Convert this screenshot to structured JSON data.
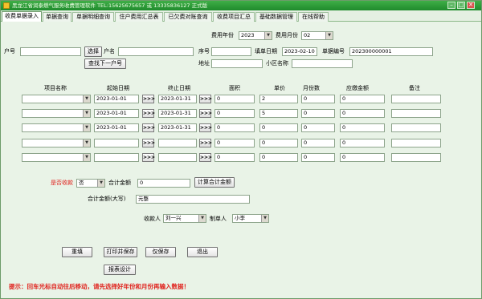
{
  "window": {
    "title": "黑龙江省润泰燃气服务收费管理软件 TEL:15625675657 或 13335836127 正式版",
    "min": "–",
    "max": "□",
    "close": "✕"
  },
  "tabs": [
    "收费单据录入",
    "单据查询",
    "单据明细查询",
    "住户费用汇总表",
    "已欠费对账查询",
    "收费项目汇总",
    "基础数据管理",
    "在线帮助"
  ],
  "period": {
    "year_label": "费用年份",
    "year_value": "2023",
    "month_label": "费用月份",
    "month_value": "02"
  },
  "customer": {
    "account_label": "户号",
    "account_value": "",
    "select_button": "选择",
    "find_next_button": "查找下一户号",
    "name_label": "户名",
    "name_value": "",
    "seq_label": "序号",
    "seq_value": "",
    "address_label": "地址",
    "address_value": "",
    "bill_date_label": "填单日期",
    "bill_date_value": "2023-02-10",
    "bill_no_label": "单据编号",
    "bill_no_value": "202300000001",
    "community_label": "小区名称",
    "community_value": ""
  },
  "table": {
    "headers": [
      "项目名称",
      "起始日期",
      "终止日期",
      "面积",
      "单价",
      "月份数",
      "应缴金额",
      "备注"
    ],
    "arrow_label": ">>>",
    "rows": [
      {
        "item": "",
        "start": "2023-01-01",
        "end": "2023-01-31",
        "area": "0",
        "price": "2",
        "months": "0",
        "amount": "0",
        "note": ""
      },
      {
        "item": "",
        "start": "2023-01-01",
        "end": "2023-01-31",
        "area": "0",
        "price": "5",
        "months": "0",
        "amount": "0",
        "note": ""
      },
      {
        "item": "",
        "start": "2023-01-01",
        "end": "2023-01-31",
        "area": "0",
        "price": "0",
        "months": "0",
        "amount": "0",
        "note": ""
      },
      {
        "item": "",
        "start": "",
        "end": "",
        "area": "0",
        "price": "0",
        "months": "0",
        "amount": "0",
        "note": ""
      },
      {
        "item": "",
        "start": "",
        "end": "",
        "area": "0",
        "price": "0",
        "months": "0",
        "amount": "0",
        "note": ""
      }
    ]
  },
  "summary": {
    "paid_label": "是否收款",
    "paid_value": "否",
    "total_label": "合计金额",
    "total_value": "0",
    "calc_button": "计算合计金额",
    "total_upper_label": "合计金额(大写)",
    "total_upper_value": "元整",
    "payee_label": "收款人",
    "payee_value": "刘一兴",
    "maker_label": "制单人",
    "maker_value": "小李"
  },
  "actions": {
    "reset": "重填",
    "print_save": "打印并保存",
    "save_only": "仅保存",
    "exit": "退出",
    "report_design": "报表设计"
  },
  "tip": "提示：回车光标自动往后移动，请先选择好年份和月份再输入数据！",
  "colors": {
    "accent": "#1f8a2c",
    "warning": "#e0221d",
    "window_bg": "#e9f3e7"
  }
}
